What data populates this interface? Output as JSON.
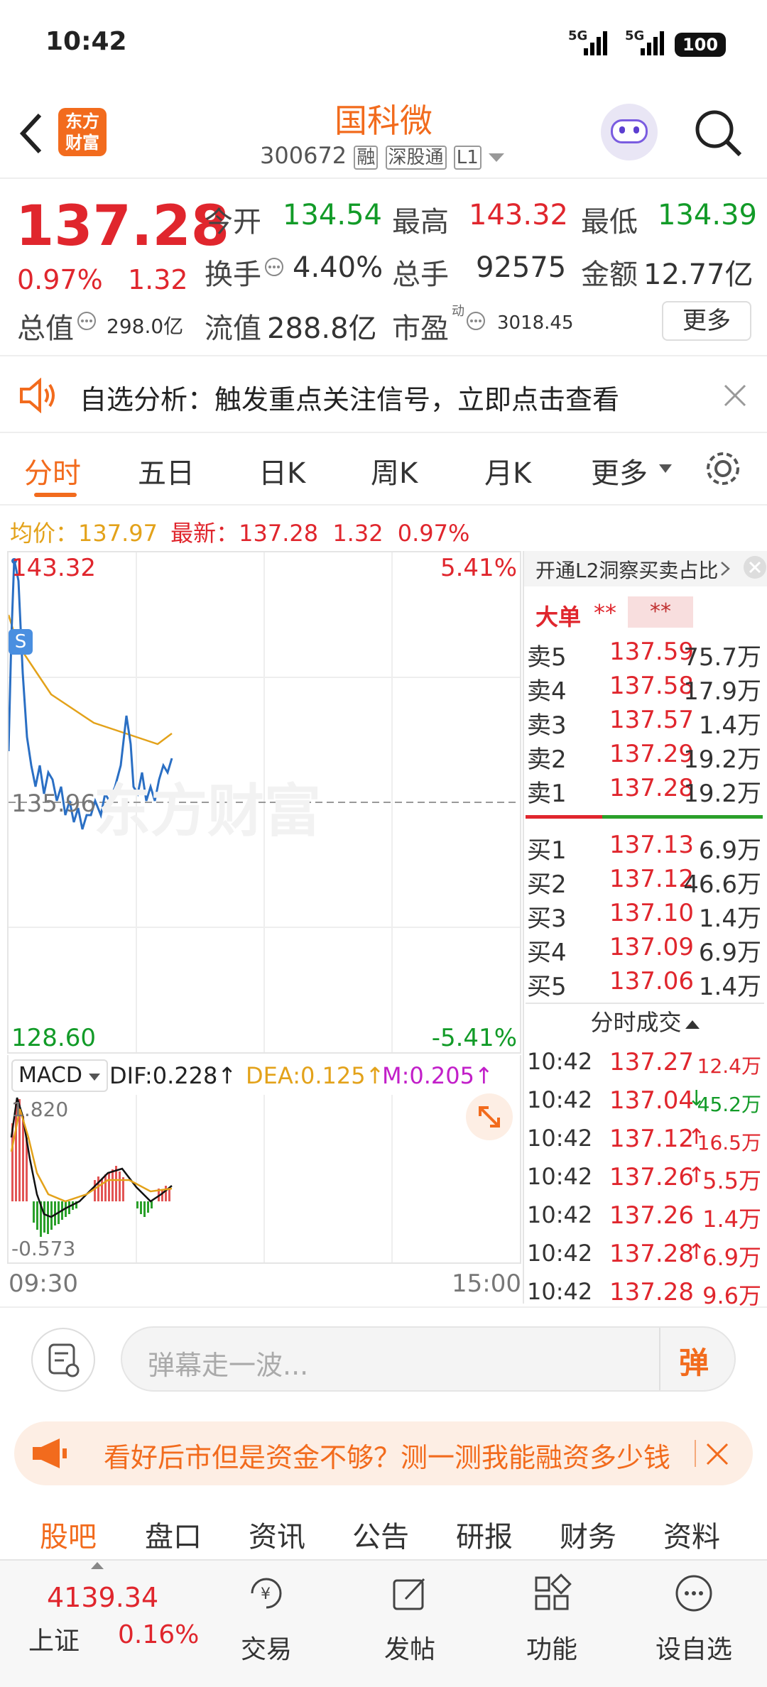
{
  "status_bar": {
    "time": "10:42",
    "signal1": "5G",
    "signal2": "5G",
    "battery": "100"
  },
  "header": {
    "logo_line1": "东方",
    "logo_line2": "财富",
    "stock_name": "国科微",
    "stock_code": "300672",
    "tag_margin": "融",
    "tag_connect": "深股通",
    "tag_level": "L1"
  },
  "quote": {
    "price": "137.28",
    "change_pct": "0.97%",
    "change": "1.32",
    "open_label": "今开",
    "open": "134.54",
    "high_label": "最高",
    "high": "143.32",
    "low_label": "最低",
    "low": "134.39",
    "turnover_label": "换手",
    "turnover": "4.40%",
    "volume_label": "总手",
    "volume": "92575",
    "amount_label": "金额",
    "amount": "12.77亿",
    "mktcap_label": "总值",
    "mktcap": "298.0亿",
    "float_label": "流值",
    "float": "288.8亿",
    "pe_label": "市盈",
    "pe_sup": "动",
    "pe": "3018.45",
    "more": "更多"
  },
  "alert": {
    "text": "自选分析：触发重点关注信号，立即点击查看"
  },
  "tabs": [
    "分时",
    "五日",
    "日K",
    "周K",
    "月K",
    "更多"
  ],
  "chart_info": {
    "avg_label": "均价：",
    "avg": "137.97",
    "latest_label": "最新：",
    "latest": "137.28",
    "chg": "1.32",
    "pct": "0.97%"
  },
  "chart": {
    "y_top": "143.32",
    "y_mid": "135.96",
    "y_bottom": "128.60",
    "pct_top": "5.41%",
    "pct_bottom": "-5.41%",
    "watermark": "东方财富",
    "marker": "S",
    "t_start": "09:30",
    "t_end": "15:00"
  },
  "macd": {
    "label": "MACD",
    "dif": "DIF:0.228↑",
    "dea": "DEA:0.125↑",
    "m": "M:0.205↑",
    "y_top": "1.820",
    "y_bottom": "-0.573"
  },
  "order_book": {
    "promo": "开通L2洞察买卖占比",
    "big_label": "大单",
    "big_val1": "**",
    "big_val2": "**",
    "asks": [
      {
        "label": "卖5",
        "price": "137.59",
        "vol": "75.7万"
      },
      {
        "label": "卖4",
        "price": "137.58",
        "vol": "17.9万"
      },
      {
        "label": "卖3",
        "price": "137.57",
        "vol": "1.4万"
      },
      {
        "label": "卖2",
        "price": "137.29",
        "vol": "19.2万"
      },
      {
        "label": "卖1",
        "price": "137.28",
        "vol": "19.2万"
      }
    ],
    "bids": [
      {
        "label": "买1",
        "price": "137.13",
        "vol": "6.9万"
      },
      {
        "label": "买2",
        "price": "137.12",
        "vol": "46.6万"
      },
      {
        "label": "买3",
        "price": "137.10",
        "vol": "1.4万"
      },
      {
        "label": "买4",
        "price": "137.09",
        "vol": "6.9万"
      },
      {
        "label": "买5",
        "price": "137.06",
        "vol": "1.4万"
      }
    ]
  },
  "trades": {
    "title": "分时成交",
    "rows": [
      {
        "time": "10:42",
        "price": "137.27",
        "arrow": "",
        "vol": "12.4万",
        "color": "red"
      },
      {
        "time": "10:42",
        "price": "137.04",
        "arrow": "↓",
        "vol": "45.2万",
        "color": "green"
      },
      {
        "time": "10:42",
        "price": "137.12",
        "arrow": "↑",
        "vol": "16.5万",
        "color": "red"
      },
      {
        "time": "10:42",
        "price": "137.26",
        "arrow": "↑",
        "vol": "5.5万",
        "color": "red"
      },
      {
        "time": "10:42",
        "price": "137.26",
        "arrow": "",
        "vol": "1.4万",
        "color": "red"
      },
      {
        "time": "10:42",
        "price": "137.28",
        "arrow": "↑",
        "vol": "6.9万",
        "color": "red"
      },
      {
        "time": "10:42",
        "price": "137.28",
        "arrow": "",
        "vol": "9.6万",
        "color": "red"
      }
    ]
  },
  "danmu": {
    "placeholder": "弹幕走一波...",
    "btn": "弹"
  },
  "promo_banner": {
    "text": "看好后市但是资金不够？测一测我能融资多少钱"
  },
  "bottom_tabs": [
    "股吧",
    "盘口",
    "资讯",
    "公告",
    "研报",
    "财务",
    "资料"
  ],
  "bottom_nav": {
    "index_value": "4139.34",
    "index_name": "上证",
    "index_pct": "0.16%",
    "items": [
      "交易",
      "发帖",
      "功能",
      "设自选"
    ]
  },
  "colors": {
    "up": "#e0262d",
    "down": "#129b28",
    "accent": "#f26b1d",
    "avg_line": "#e3a21a"
  }
}
